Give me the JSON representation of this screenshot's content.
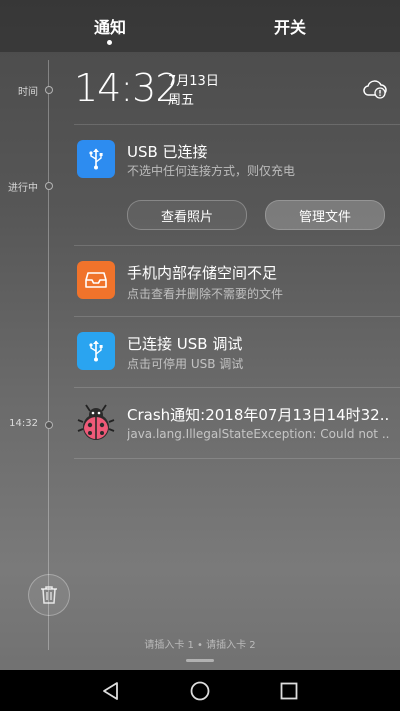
{
  "tabs": {
    "notify": "通知",
    "switches": "开关"
  },
  "timeline": {
    "time_label": "时间",
    "ongoing_label": "进行中",
    "crash_time": "14:32"
  },
  "clock": {
    "time": "14:32",
    "date": "7月13日",
    "weekday": "周五"
  },
  "notifications": [
    {
      "icon": "usb-icon",
      "color": "#2d8cf0",
      "title": "USB 已连接",
      "subtitle": "不选中任何连接方式，则仅充电"
    },
    {
      "icon": "storage-tray-icon",
      "color": "#f0732b",
      "title": "手机内部存储空间不足",
      "subtitle": "点击查看并删除不需要的文件"
    },
    {
      "icon": "usb-icon",
      "color": "#2aa4f0",
      "title": "已连接 USB 调试",
      "subtitle": "点击可停用 USB 调试"
    },
    {
      "icon": "ladybug-icon",
      "color": "#e8506a",
      "title": "Crash通知:2018年07月13日14时32...",
      "subtitle": "java.lang.IllegalStateException: Could not ..."
    }
  ],
  "usb_actions": {
    "view_photos": "查看照片",
    "manage_files": "管理文件"
  },
  "sim_status": "请插入卡 1 • 请插入卡 2",
  "icons": {
    "cloud": "cloud-alert-icon",
    "trash": "trash-icon",
    "back": "back-icon",
    "home": "home-icon",
    "recents": "recents-icon"
  }
}
